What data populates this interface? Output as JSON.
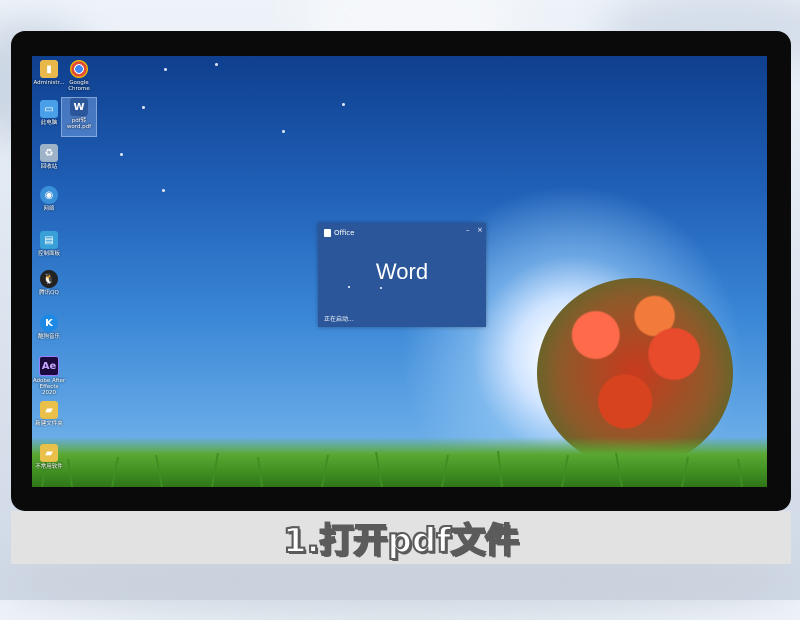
{
  "desktop_icons": [
    {
      "id": "admin",
      "label": "Administr...",
      "icon": "user-folder-icon",
      "color": "#e8b84a"
    },
    {
      "id": "chrome",
      "label": "Google Chrome",
      "icon": "chrome-icon",
      "color": "#dd4b39"
    },
    {
      "id": "computer",
      "label": "此电脑",
      "icon": "computer-icon",
      "color": "#4aa0e8"
    },
    {
      "id": "pdf",
      "label": "pdf转 word.pdf",
      "icon": "word-doc-icon",
      "color": "#2b579a"
    },
    {
      "id": "recycle",
      "label": "回收站",
      "icon": "recycle-bin-icon",
      "color": "#9fb3c8"
    },
    {
      "id": "network",
      "label": "网络",
      "icon": "network-icon",
      "color": "#3a8fd9"
    },
    {
      "id": "control",
      "label": "控制面板",
      "icon": "control-panel-icon",
      "color": "#3aa0d8"
    },
    {
      "id": "qq",
      "label": "腾讯QQ",
      "icon": "qq-icon",
      "color": "#222222"
    },
    {
      "id": "kugou",
      "label": "酷狗音乐",
      "icon": "kugou-icon",
      "color": "#1e88e5"
    },
    {
      "id": "ae",
      "label": "Adobe After Effects 2020",
      "icon": "after-effects-icon",
      "color": "#1a0a3d"
    },
    {
      "id": "newfolder",
      "label": "新建文件夹",
      "icon": "folder-icon",
      "color": "#e8c04a"
    },
    {
      "id": "unused",
      "label": "不常用软件",
      "icon": "folder-icon",
      "color": "#e8c04a"
    }
  ],
  "splash": {
    "brand": "Office",
    "app_name": "Word",
    "status": "正在启动...",
    "minimize": "–",
    "close": "×"
  },
  "caption": "1.打开pdf文件",
  "colors": {
    "word_blue": "#2b579a"
  }
}
